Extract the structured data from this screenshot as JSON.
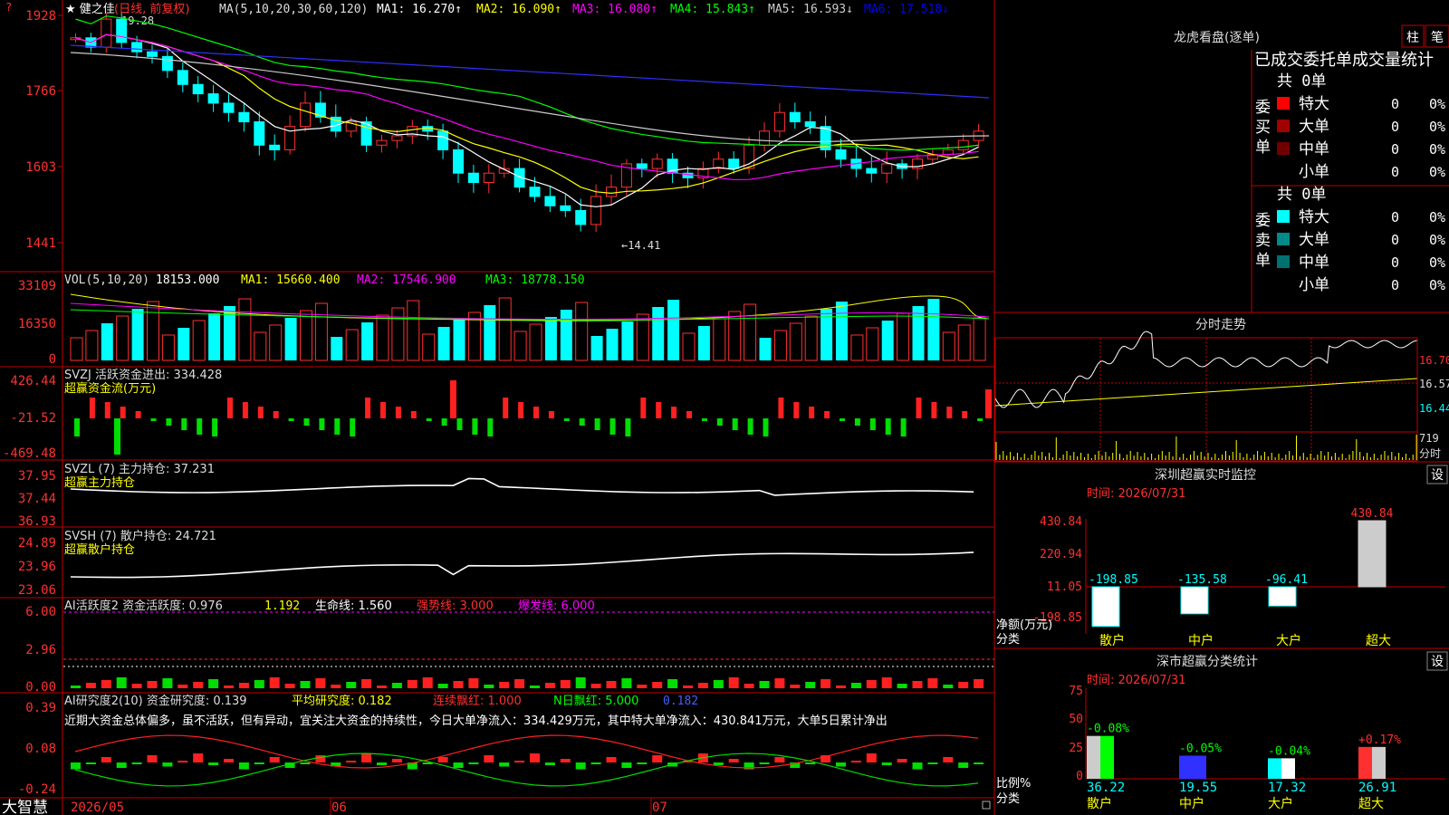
{
  "stock": {
    "name": "★ 健之佳",
    "mode": "(日线, 前复权)",
    "corner_mark": "?"
  },
  "ma_header": {
    "label": "MA(5,10,20,30,60,120)",
    "items": [
      {
        "text": "MA1: 16.270",
        "color": "#ffffff",
        "arrow": "↑"
      },
      {
        "text": "MA2: 16.090",
        "color": "#ffff00",
        "arrow": "↑"
      },
      {
        "text": "MA3: 16.080",
        "color": "#ff00ff",
        "arrow": "↑"
      },
      {
        "text": "MA4: 15.843",
        "color": "#00ff00",
        "arrow": "↑"
      },
      {
        "text": "MA5: 16.593",
        "color": "#cccccc",
        "arrow": "↓"
      },
      {
        "text": "MA6: 17.518",
        "color": "#0000ff",
        "arrow": "↓"
      }
    ]
  },
  "price_axis": [
    "1928",
    "1766",
    "1603",
    "1441"
  ],
  "price_annotations": {
    "high": "19.28",
    "low": "←14.41"
  },
  "vol": {
    "label": "VOL(5,10,20)",
    "value": "18153.000",
    "ma1": "MA1: 15660.400",
    "ma2": "MA2: 17546.900",
    "ma3": "MA3: 18778.150",
    "axis": [
      "33109",
      "16350",
      "0"
    ]
  },
  "svzj": {
    "label": "SVZJ  活跃资金进出: 334.428",
    "sub": "超赢资金流(万元)",
    "axis": [
      "426.44",
      "-21.52",
      "-469.48"
    ]
  },
  "svzl": {
    "label": "SVZL (7) 主力持仓: 37.231",
    "sub": "超赢主力持仓",
    "axis": [
      "37.95",
      "37.44",
      "36.93"
    ]
  },
  "svsh": {
    "label": "SVSH (7) 散户持仓: 24.721",
    "sub": "超赢散户持仓",
    "axis": [
      "24.89",
      "23.96",
      "23.06"
    ]
  },
  "ai_active": {
    "label": "AI活跃度2 资金活跃度: 0.976",
    "v2": "1.192",
    "life": "生命线: 1.560",
    "strong": "强势线: 3.000",
    "burst": "爆发线: 6.000",
    "axis": [
      "6.00",
      "2.96",
      "0.00"
    ]
  },
  "ai_research": {
    "label": "AI研究度2(10) 资金研究度: 0.139",
    "avg": "平均研究度: 0.182",
    "cont": "连续飘红: 1.000",
    "nday": "N日飘红: 5.000",
    "last": "0.182",
    "axis": [
      "0.39",
      "0.08",
      "-0.24"
    ],
    "comment": "近期大资金总体偏多，虽不活跃，但有异动，宜关注大资金的持续性，今日大单净流入：334.429万元，其中特大单净流入：430.841万元，大单5日累计净出"
  },
  "date_axis": [
    "2026/05",
    "06",
    "07"
  ],
  "brand": "大智慧",
  "right": {
    "dragon_title": "龙虎看盘(逐单)",
    "tab1": "柱",
    "tab2": "笔",
    "stat_title": "已成交委托单成交量统计",
    "buy": {
      "side": "委买单",
      "total": "共 0单",
      "rows": [
        {
          "label": "特大",
          "qty": "0",
          "pct": "0%",
          "color": "#ff0000"
        },
        {
          "label": "大单",
          "qty": "0",
          "pct": "0%",
          "color": "#a00000"
        },
        {
          "label": "中单",
          "qty": "0",
          "pct": "0%",
          "color": "#700000"
        },
        {
          "label": "小单",
          "qty": "0",
          "pct": "0%",
          "color": "#000000"
        }
      ]
    },
    "sell": {
      "side": "委卖单",
      "total": "共 0单",
      "rows": [
        {
          "label": "特大",
          "qty": "0",
          "pct": "0%",
          "color": "#00ffff"
        },
        {
          "label": "大单",
          "qty": "0",
          "pct": "0%",
          "color": "#008a8a"
        },
        {
          "label": "中单",
          "qty": "0",
          "pct": "0%",
          "color": "#007070"
        },
        {
          "label": "小单",
          "qty": "0",
          "pct": "0%",
          "color": "#000000"
        }
      ]
    },
    "intraday": {
      "title": "分时走势",
      "axis": [
        "16.70",
        "16.57",
        "16.44"
      ],
      "vol": "719",
      "vol_unit": "分时"
    },
    "monitor": {
      "title": "深圳超赢实时监控",
      "set": "设",
      "time": "时间: 2026/07/31",
      "axis": [
        "430.84",
        "220.94",
        "11.05",
        "-198.85"
      ],
      "ylabel": "净额(万元)",
      "xlabel": "分类",
      "cats": [
        "散户",
        "中户",
        "大户",
        "超大"
      ],
      "values": [
        "-198.85",
        "-135.58",
        "-96.41",
        "430.84"
      ]
    },
    "classify": {
      "title": "深市超赢分类统计",
      "set": "设",
      "time": "时间: 2026/07/31",
      "axis": [
        "75",
        "50",
        "25",
        "0"
      ],
      "ylabel": "比例%",
      "xlabel": "分类",
      "cats": [
        "散户",
        "中户",
        "大户",
        "超大"
      ],
      "pcts": [
        "36.22",
        "19.55",
        "17.32",
        "26.91"
      ],
      "changes": [
        "-0.08%",
        "-0.05%",
        "-0.04%",
        "+0.17%"
      ]
    }
  }
}
